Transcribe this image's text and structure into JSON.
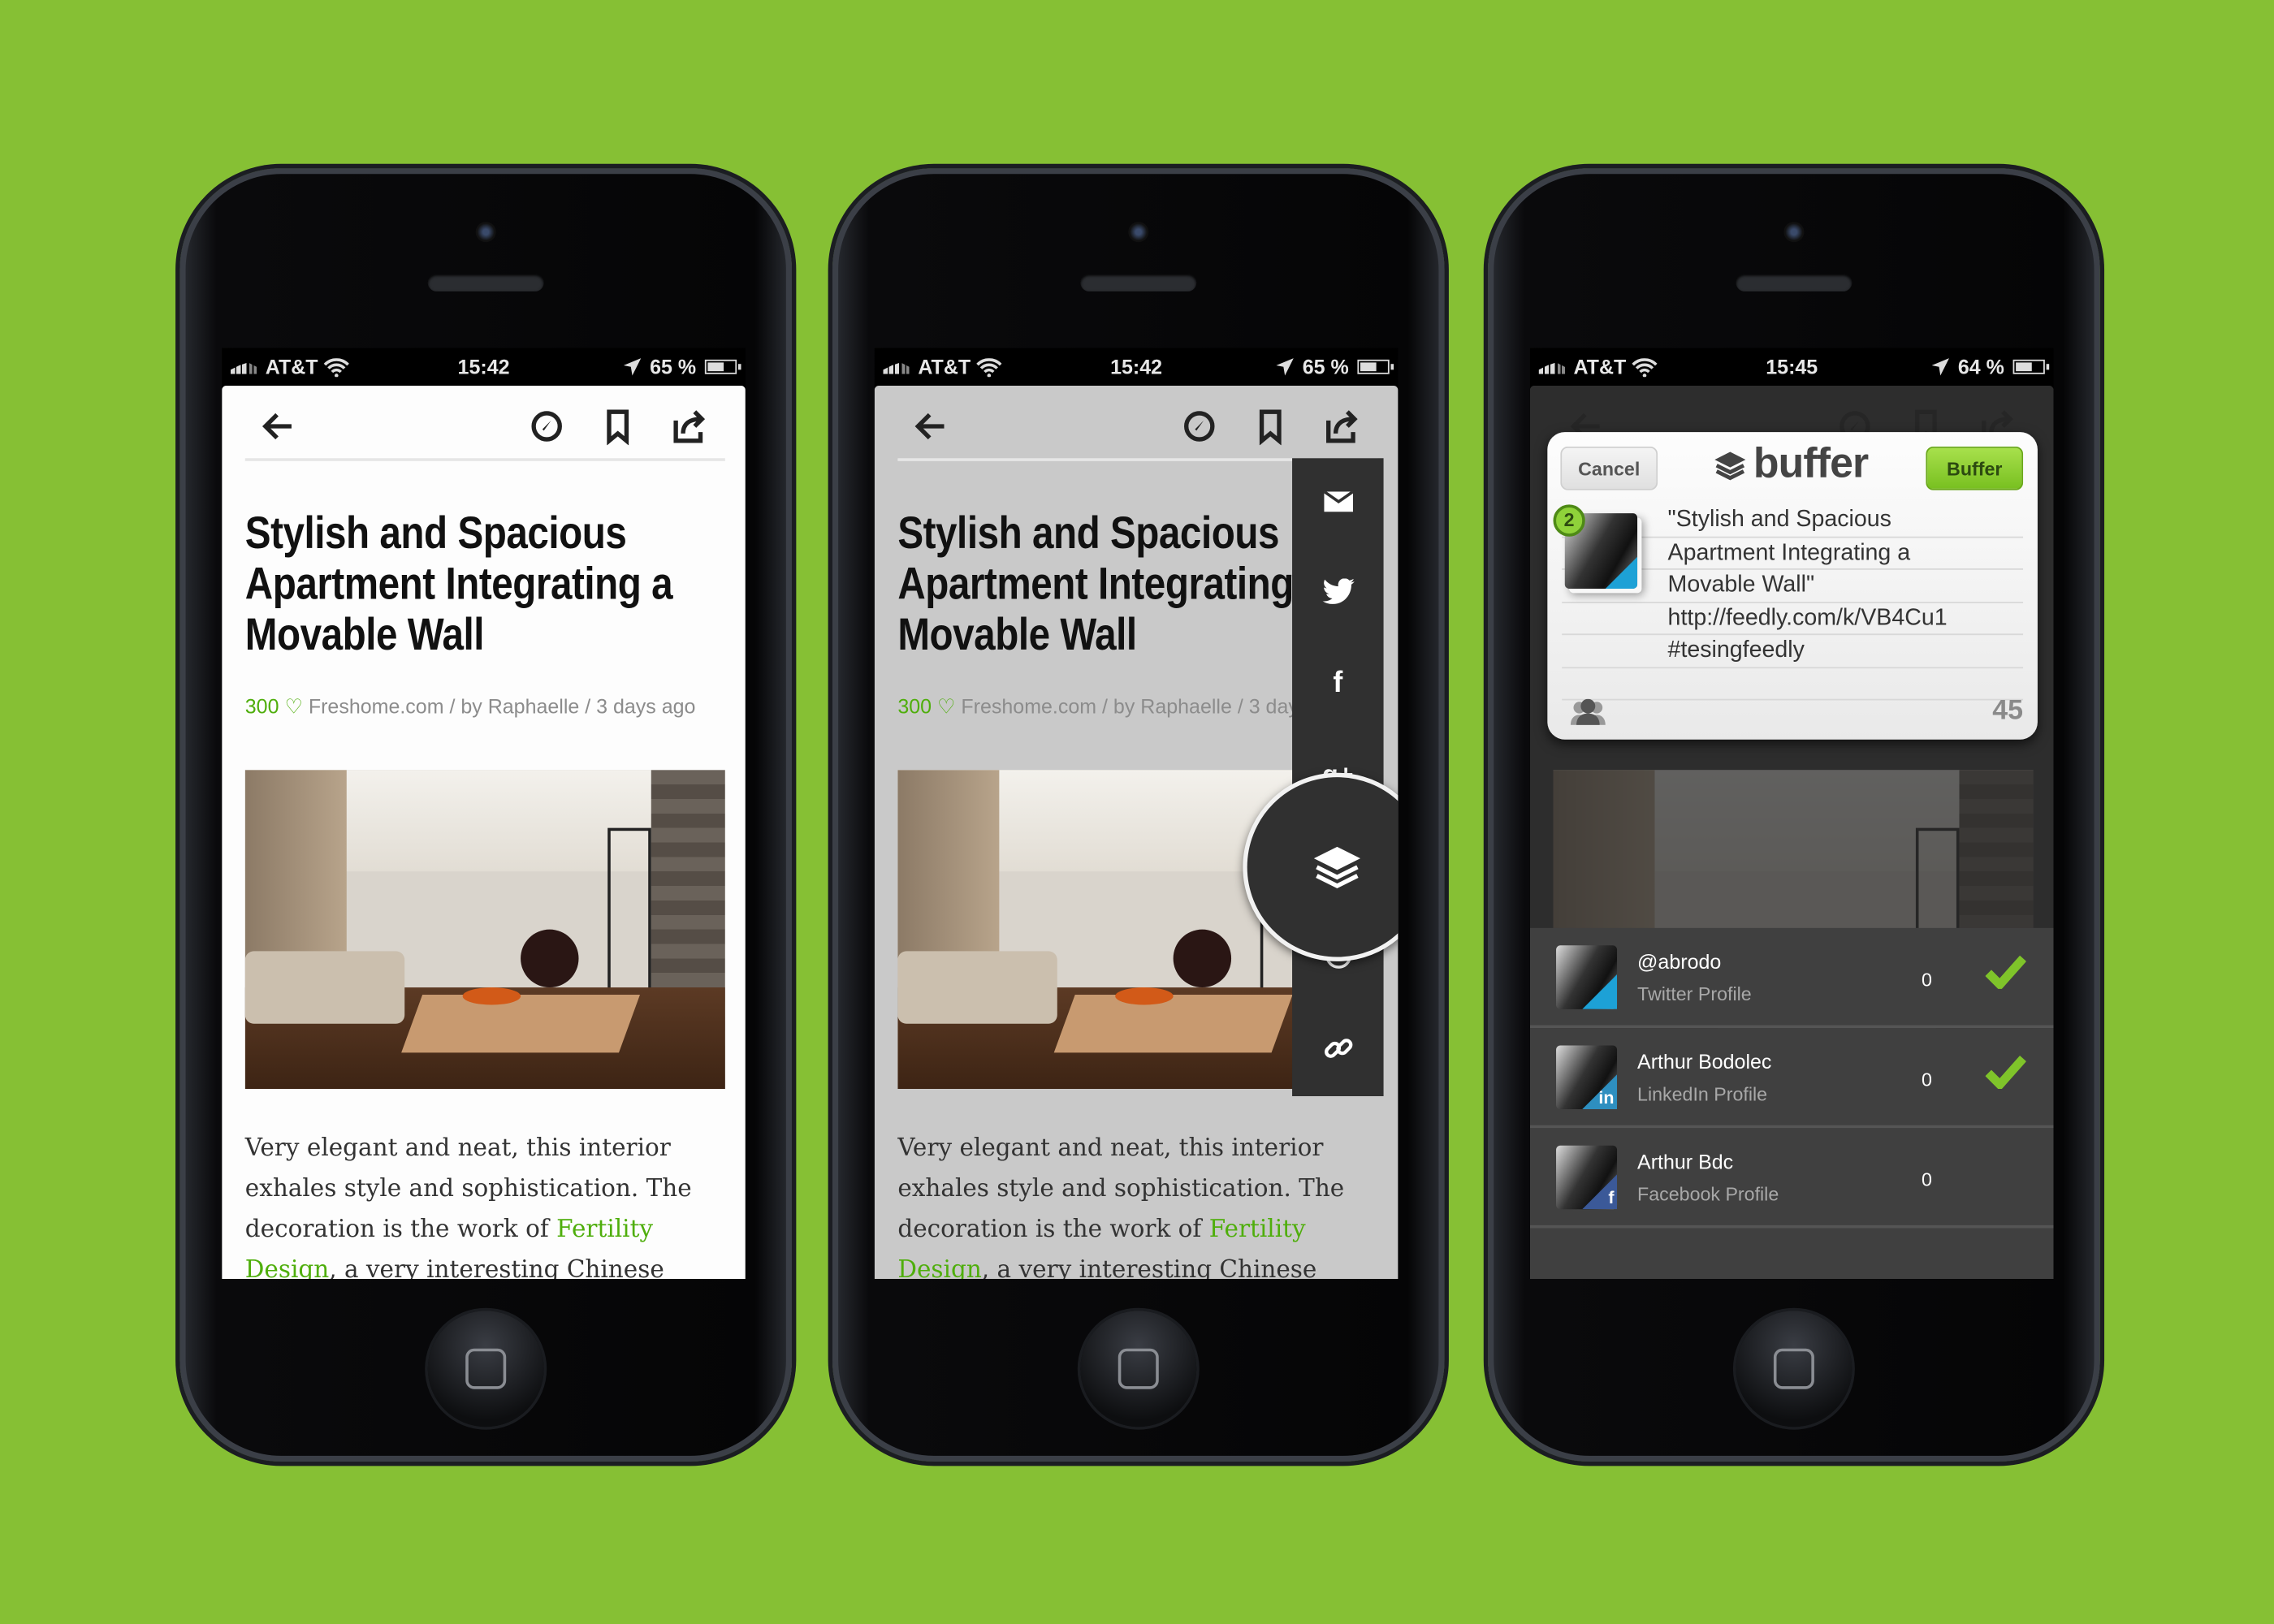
{
  "colors": {
    "background": "#86c034",
    "accent_green": "#4fae0c",
    "share_bar": "#303030",
    "twitter": "#1da1d6",
    "linkedin": "#2e8fc0",
    "facebook": "#3b5998"
  },
  "phones": [
    {
      "status": {
        "carrier": "AT&T",
        "time": "15:42",
        "battery": "65 %",
        "battery_level": 65
      },
      "article": {
        "title": "Stylish and Spacious Apartment Integrating a Movable Wall",
        "likes": "300",
        "source": "Freshome.com / by Raphaelle / 3 days ago",
        "body_pre": "Very elegant and neat, this interior exhales style and sophistication. The decoration is the work of ",
        "link": "Fertility Design",
        "body_post": ", a very interesting Chinese studio, that"
      }
    },
    {
      "status": {
        "carrier": "AT&T",
        "time": "15:42",
        "battery": "65 %",
        "battery_level": 65
      },
      "article": {
        "title": "Stylish and Spacious Apartment Integrating a Movable Wall",
        "likes": "300",
        "source": "Freshome.com / by Raphaelle / 3 days ago",
        "body_pre": "Very elegant and neat, this interior exhales style and sophistication. The decoration is the work of ",
        "link": "Fertility Design",
        "body_post": ", a very interesting Chinese studio, that"
      },
      "share_icons": [
        "mail-icon",
        "twitter-icon",
        "facebook-icon",
        "google-plus-icon",
        "buffer-icon",
        "pocket-icon",
        "link-icon"
      ]
    },
    {
      "status": {
        "carrier": "AT&T",
        "time": "15:45",
        "battery": "64 %",
        "battery_level": 64
      },
      "buffer": {
        "cancel": "Cancel",
        "logo": "buffer",
        "submit": "Buffer",
        "profile_badge": "2",
        "lines": [
          "\"Stylish and Spacious",
          "Apartment Integrating a",
          "Movable Wall\"",
          "http://feedly.com/k/VB4Cu1",
          "#tesingfeedly",
          ""
        ],
        "char_count": "45"
      },
      "profiles": [
        {
          "name": "@abrodo",
          "type": "Twitter Profile",
          "count": "0",
          "selected": true,
          "network": "twitter"
        },
        {
          "name": "Arthur Bodolec",
          "type": "LinkedIn Profile",
          "count": "0",
          "selected": true,
          "network": "linkedin"
        },
        {
          "name": "Arthur Bdc",
          "type": "Facebook Profile",
          "count": "0",
          "selected": false,
          "network": "facebook"
        }
      ]
    }
  ]
}
